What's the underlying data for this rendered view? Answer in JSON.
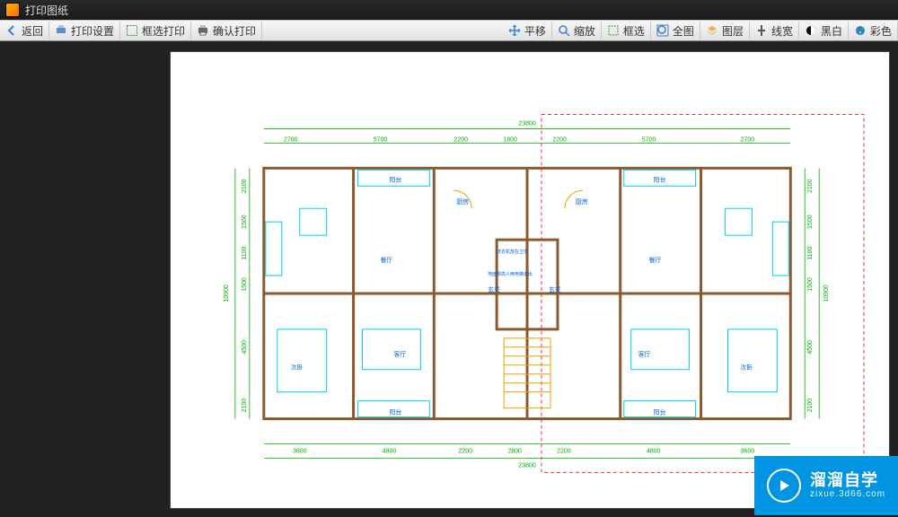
{
  "window": {
    "title": "打印图纸"
  },
  "toolbar_left": [
    {
      "icon": "back",
      "label": "返回"
    },
    {
      "icon": "print-settings",
      "label": "打印设置"
    },
    {
      "icon": "frame-select",
      "label": "框选打印"
    },
    {
      "icon": "confirm-print",
      "label": "确认打印"
    }
  ],
  "toolbar_right": [
    {
      "icon": "pan",
      "label": "平移"
    },
    {
      "icon": "zoom",
      "label": "缩放"
    },
    {
      "icon": "box-select",
      "label": "框选"
    },
    {
      "icon": "full",
      "label": "全图"
    },
    {
      "icon": "layers",
      "label": "图层"
    },
    {
      "icon": "lineweight",
      "label": "线宽"
    },
    {
      "icon": "bw",
      "label": "黑白"
    },
    {
      "icon": "color",
      "label": "彩色"
    }
  ],
  "rooms": {
    "balcony": "阳台",
    "kitchen": "厨房",
    "dining": "餐厅",
    "entry": "玄关",
    "living": "客厅",
    "bedroom": "次卧",
    "note1": "洗衣机放在卫生",
    "note2": "地面限高人两电梯走出"
  },
  "dims_top": [
    "23800",
    "2700",
    "5700",
    "2200",
    "1800",
    "2200",
    "5700",
    "2700"
  ],
  "dims_bottom": [
    "23800",
    "3600",
    "4800",
    "2200",
    "2800",
    "2200",
    "4800",
    "3600"
  ],
  "dims_left": [
    "10900",
    "2100",
    "1500",
    "1100",
    "1500",
    "4500",
    "2100"
  ],
  "dims_right": [
    "10900",
    "2100",
    "1500",
    "1100",
    "1500",
    "4500",
    "2100"
  ],
  "watermark": {
    "brand": "溜溜自学",
    "url": "zixue.3d66.com"
  }
}
